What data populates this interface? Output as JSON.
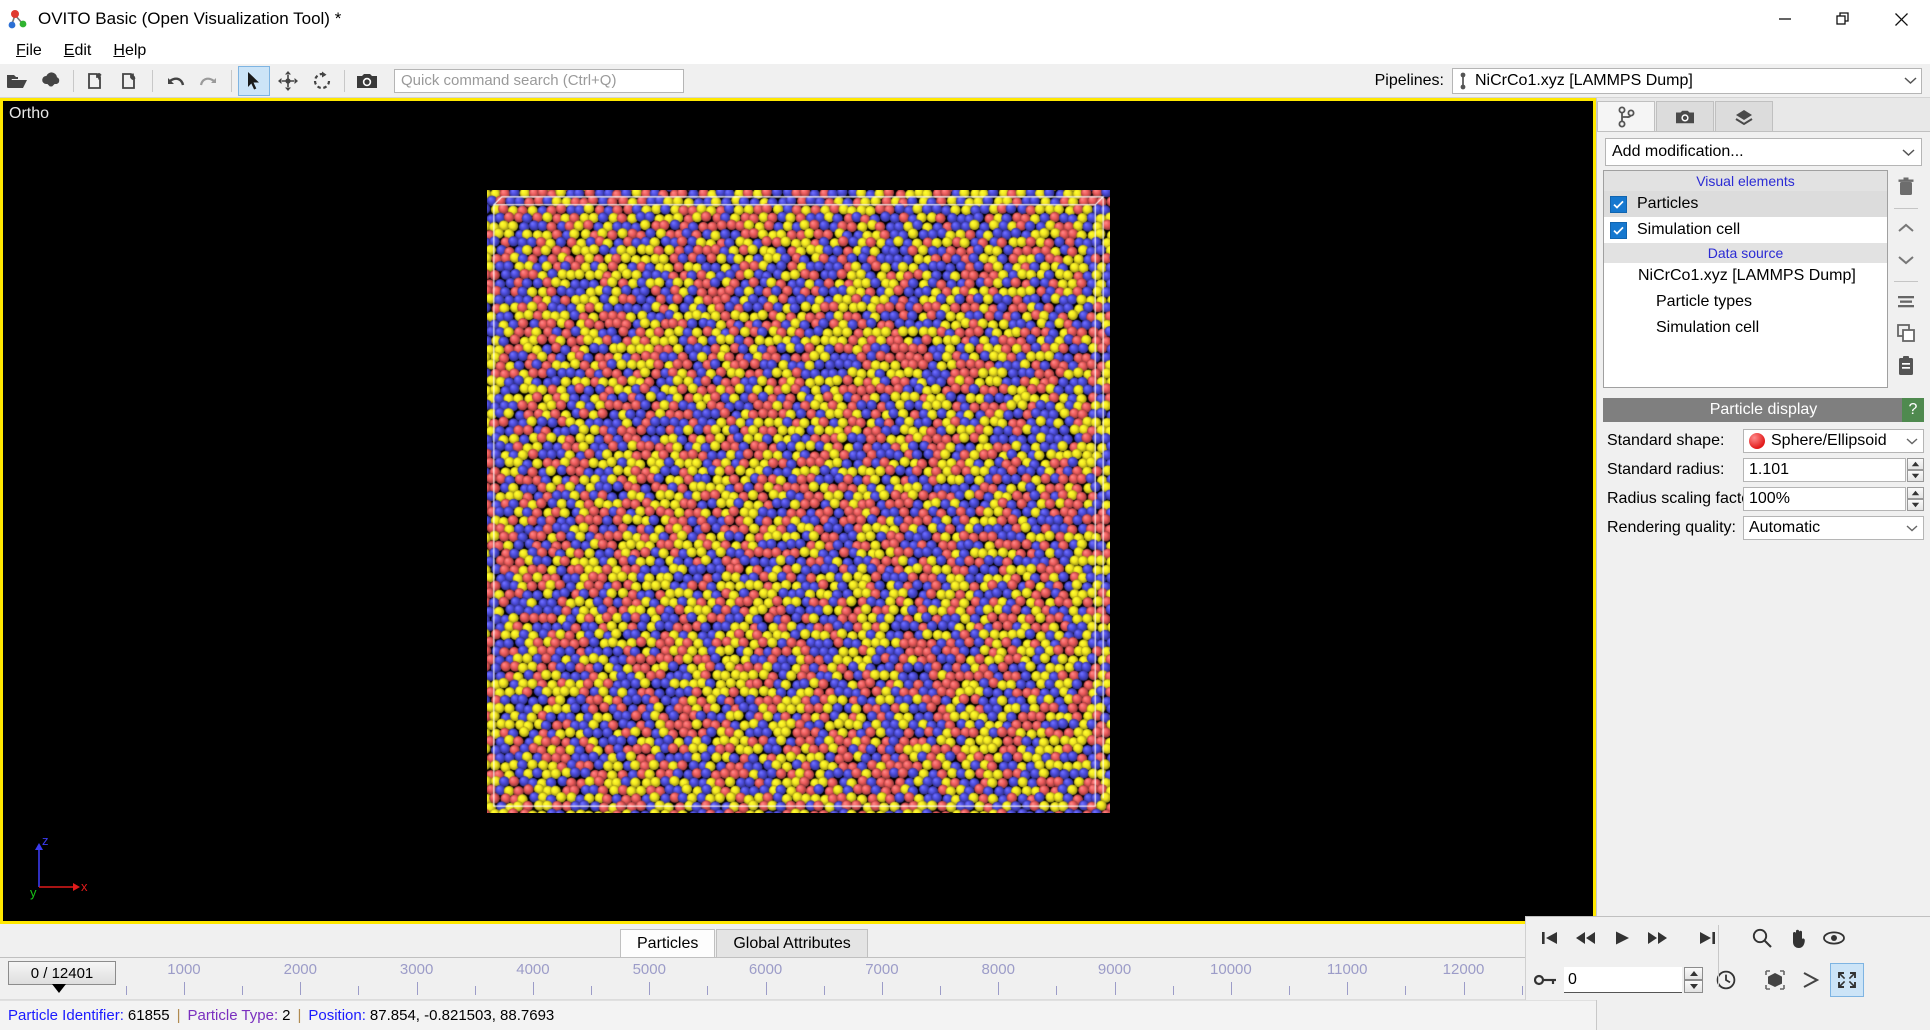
{
  "window": {
    "title": "OVITO Basic (Open Visualization Tool) *",
    "logo_icon": "ovito-molecule-logo",
    "minimize_label": "—",
    "restore_label": "restore-icon",
    "close_label": "✕"
  },
  "menu": [
    {
      "label": "File",
      "mnemonic": "F"
    },
    {
      "label": "Edit",
      "mnemonic": "E"
    },
    {
      "label": "Help",
      "mnemonic": "H"
    }
  ],
  "toolbar": {
    "buttons": [
      {
        "name": "open-file-button",
        "icon": "open-folder-icon",
        "active": false
      },
      {
        "name": "import-remote-file-button",
        "icon": "cloud-download-icon",
        "active": false
      },
      {
        "name": "load-session-button",
        "icon": "file-open-session-icon",
        "active": false
      },
      {
        "name": "save-session-button",
        "icon": "file-save-session-icon",
        "active": false
      },
      {
        "name": "undo-button",
        "icon": "undo-arrow-icon",
        "active": false
      },
      {
        "name": "redo-button",
        "icon": "redo-arrow-icon",
        "active": false
      },
      {
        "name": "select-mode-button",
        "icon": "cursor-arrow-icon",
        "active": true
      },
      {
        "name": "translate-mode-button",
        "icon": "move-cross-arrows-icon",
        "active": false
      },
      {
        "name": "rotate-mode-button",
        "icon": "rotate-arrow-icon",
        "active": false
      },
      {
        "name": "render-button",
        "icon": "camera-icon",
        "active": false
      }
    ],
    "search_placeholder": "Quick command search (Ctrl+Q)",
    "search_value": ""
  },
  "pipelines": {
    "label": "Pipelines:",
    "selected": "NiCrCo1.xyz [LAMMPS Dump]",
    "selector_icon": "pipeline-node-icon",
    "dropdown_icon": "chevron-down-icon"
  },
  "viewport": {
    "label": "Ortho",
    "active_border_color": "#ffe800",
    "background": "#000000",
    "axis_tripod": {
      "x_label": "x",
      "x_color": "#e01b1b",
      "y_label": "y",
      "y_color": "#17c217",
      "z_label": "z",
      "z_color": "#3b3bef"
    },
    "simulation_cell": {
      "line_color": "#ffffff",
      "visible": true
    },
    "particle_colors": {
      "type_1_red": "#ea5a5a",
      "type_2_yellow": "#f2e521",
      "type_3_blue": "#4b4bd8"
    }
  },
  "command_panel": {
    "tabs": [
      {
        "name": "tab-pipeline",
        "icon": "pipeline-branch-icon",
        "active": true
      },
      {
        "name": "tab-render",
        "icon": "camera-icon",
        "active": false
      },
      {
        "name": "tab-overlays",
        "icon": "layers-diamond-icon",
        "active": false
      }
    ],
    "add_modification": {
      "text": "Add modification...",
      "dropdown_icon": "chevron-down-icon"
    },
    "pipeline_tree": {
      "visual_elements_header": "Visual elements",
      "visual_elements": [
        {
          "label": "Particles",
          "checked": true,
          "selected": true
        },
        {
          "label": "Simulation cell",
          "checked": true,
          "selected": false
        }
      ],
      "data_source_header": "Data source",
      "data_source": [
        {
          "label": "NiCrCo1.xyz [LAMMPS Dump]",
          "indent": 1
        },
        {
          "label": "Particle types",
          "indent": 2
        },
        {
          "label": "Simulation cell",
          "indent": 2
        }
      ]
    },
    "side_tools": [
      {
        "name": "delete-modifier-button",
        "icon": "trash-icon"
      },
      {
        "name": "move-up-button",
        "icon": "chevron-up-icon"
      },
      {
        "name": "move-down-button",
        "icon": "chevron-down-icon"
      },
      {
        "name": "toggle-modifier-button",
        "icon": "list-lines-icon"
      },
      {
        "name": "copy-pipeline-button",
        "icon": "copy-icon"
      },
      {
        "name": "paste-pipeline-button",
        "icon": "clipboard-icon"
      }
    ],
    "particle_display": {
      "title": "Particle display",
      "help_label": "?",
      "rows": [
        {
          "label": "Standard shape:",
          "value": "Sphere/Ellipsoid",
          "control": "combo-swatch"
        },
        {
          "label": "Standard radius:",
          "value": "1.101",
          "control": "spinner"
        },
        {
          "label": "Radius scaling factor:",
          "value": "100%",
          "control": "spinner"
        },
        {
          "label": "Rendering quality:",
          "value": "Automatic",
          "control": "combo"
        }
      ]
    }
  },
  "data_inspector": {
    "tabs": [
      {
        "label": "Particles",
        "active": true
      },
      {
        "label": "Global Attributes",
        "active": false
      }
    ],
    "collapse_icon": "chevron-up-icon"
  },
  "timeline": {
    "current_frame_label": "0 / 12401",
    "current_frame": 0,
    "total_frames": 12401,
    "tick_labels": [
      "1000",
      "2000",
      "3000",
      "4000",
      "5000",
      "6000",
      "7000",
      "8000",
      "9000",
      "10000",
      "11000",
      "12000"
    ]
  },
  "playback": {
    "buttons": [
      {
        "name": "goto-start-button",
        "icon": "skip-start-icon"
      },
      {
        "name": "previous-frame-button",
        "icon": "rewind-icon"
      },
      {
        "name": "play-button",
        "icon": "play-icon"
      },
      {
        "name": "next-frame-button",
        "icon": "fast-forward-icon"
      },
      {
        "name": "goto-end-button",
        "icon": "skip-end-icon"
      }
    ],
    "auto_key_icon": "key-icon",
    "frame_value": "0",
    "animation_settings_icon": "clock-icon",
    "viewport_tools": [
      {
        "name": "zoom-tool-button",
        "icon": "magnifier-icon",
        "active": false
      },
      {
        "name": "pan-tool-button",
        "icon": "hand-icon",
        "active": false
      },
      {
        "name": "orbit-tool-button",
        "icon": "orbit-eye-icon",
        "active": false
      },
      {
        "name": "zoom-scene-extents-button",
        "icon": "box-extents-icon",
        "active": false
      },
      {
        "name": "field-of-view-button",
        "icon": "fov-arrow-icon",
        "active": false
      },
      {
        "name": "maximize-viewport-button",
        "icon": "maximize-arrows-icon",
        "active": true
      }
    ]
  },
  "statusbar": {
    "fields": [
      {
        "label": "Particle Identifier:",
        "value": "61855",
        "color": "blue"
      },
      {
        "label": "Particle Type:",
        "value": "2",
        "color": "purple"
      },
      {
        "label": "Position:",
        "value": "87.854, -0.821503, 88.7693",
        "color": "blue"
      }
    ],
    "separator": "|"
  }
}
